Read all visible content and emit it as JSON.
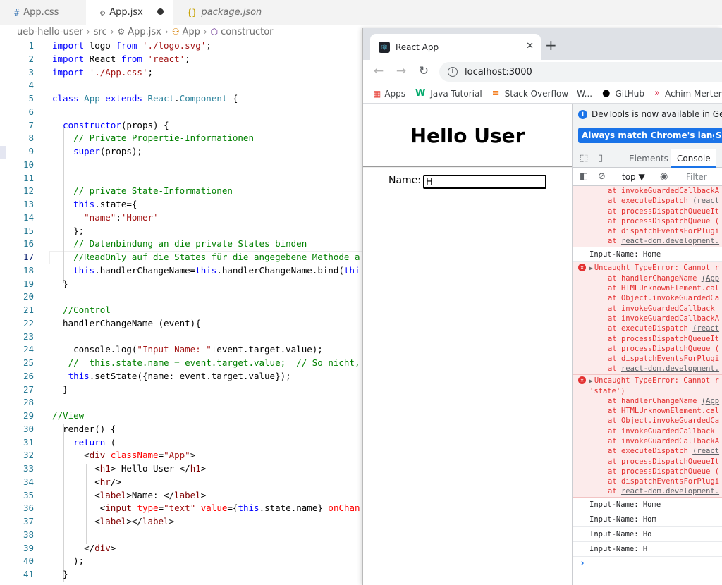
{
  "vscode": {
    "tabs": [
      {
        "icon": "#",
        "label": "App.css"
      },
      {
        "icon": "⚙",
        "label": "App.jsx"
      },
      {
        "icon": "{}",
        "label": "package.json"
      }
    ],
    "breadcrumb": [
      "ueb-hello-user",
      "src",
      "App.jsx",
      "App",
      "constructor"
    ]
  },
  "code_lines": [
    {
      "n": "1",
      "t": [
        [
          "kw",
          "import"
        ],
        [
          "",
          " logo "
        ],
        [
          "kw",
          "from"
        ],
        [
          "",
          " "
        ],
        [
          "str",
          "'./logo.svg'"
        ],
        [
          "",
          ";"
        ]
      ]
    },
    {
      "n": "2",
      "t": [
        [
          "kw",
          "import"
        ],
        [
          "",
          " React "
        ],
        [
          "kw",
          "from"
        ],
        [
          "",
          " "
        ],
        [
          "str",
          "'react'"
        ],
        [
          "",
          ";"
        ]
      ]
    },
    {
      "n": "3",
      "t": [
        [
          "kw",
          "import"
        ],
        [
          "",
          " "
        ],
        [
          "str",
          "'./App.css'"
        ],
        [
          "",
          ";"
        ]
      ]
    },
    {
      "n": "4",
      "t": []
    },
    {
      "n": "5",
      "t": [
        [
          "kw",
          "class"
        ],
        [
          "",
          " "
        ],
        [
          "cls",
          "App"
        ],
        [
          "",
          " "
        ],
        [
          "kw",
          "extends"
        ],
        [
          "",
          " "
        ],
        [
          "cls",
          "React"
        ],
        [
          "",
          "."
        ],
        [
          "cls",
          "Component"
        ],
        [
          "",
          " {"
        ]
      ]
    },
    {
      "n": "6",
      "t": []
    },
    {
      "n": "7",
      "t": [
        [
          "",
          "  "
        ],
        [
          "kw",
          "constructor"
        ],
        [
          "",
          "(props) {"
        ]
      ]
    },
    {
      "n": "8",
      "t": [
        [
          "",
          "    "
        ],
        [
          "cmt",
          "// Private Propertie-Informationen"
        ]
      ]
    },
    {
      "n": "9",
      "t": [
        [
          "",
          "    "
        ],
        [
          "kw",
          "super"
        ],
        [
          "",
          "(props);"
        ]
      ]
    },
    {
      "n": "10",
      "t": []
    },
    {
      "n": "11",
      "t": []
    },
    {
      "n": "12",
      "t": [
        [
          "",
          "    "
        ],
        [
          "cmt",
          "// private State-Informationen"
        ]
      ]
    },
    {
      "n": "13",
      "t": [
        [
          "",
          "    "
        ],
        [
          "kw",
          "this"
        ],
        [
          "",
          ".state={"
        ]
      ]
    },
    {
      "n": "14",
      "t": [
        [
          "",
          "      "
        ],
        [
          "str",
          "\"name\""
        ],
        [
          "",
          ":"
        ],
        [
          "str",
          "'Homer'"
        ]
      ]
    },
    {
      "n": "15",
      "t": [
        [
          "",
          "    };"
        ]
      ]
    },
    {
      "n": "16",
      "t": [
        [
          "",
          "    "
        ],
        [
          "cmt",
          "// Datenbindung an die private States binden"
        ]
      ]
    },
    {
      "n": "17",
      "t": [
        [
          "",
          "    "
        ],
        [
          "cmt",
          "//ReadOnly auf die States für die angegebene Methode a"
        ]
      ]
    },
    {
      "n": "18",
      "t": [
        [
          "",
          "    "
        ],
        [
          "kw",
          "this"
        ],
        [
          "",
          ".handlerChangeName="
        ],
        [
          "kw",
          "this"
        ],
        [
          "",
          ".handlerChangeName.bind("
        ],
        [
          "kw",
          "thi"
        ]
      ]
    },
    {
      "n": "19",
      "t": [
        [
          "",
          "  }"
        ]
      ]
    },
    {
      "n": "20",
      "t": []
    },
    {
      "n": "21",
      "t": [
        [
          "",
          "  "
        ],
        [
          "cmt",
          "//Control"
        ]
      ]
    },
    {
      "n": "22",
      "t": [
        [
          "",
          "  handlerChangeName (event){"
        ]
      ]
    },
    {
      "n": "23",
      "t": []
    },
    {
      "n": "24",
      "t": [
        [
          "",
          "    console.log("
        ],
        [
          "str",
          "\"Input-Name: \""
        ],
        [
          "",
          "+event.target.value);"
        ]
      ]
    },
    {
      "n": "25",
      "t": [
        [
          "",
          "   "
        ],
        [
          "cmt",
          "//  this.state.name = event.target.value;  // So nicht,"
        ]
      ]
    },
    {
      "n": "26",
      "t": [
        [
          "",
          "   "
        ],
        [
          "kw",
          "this"
        ],
        [
          "",
          ".setState({name: event.target.value});"
        ]
      ]
    },
    {
      "n": "27",
      "t": [
        [
          "",
          "  }"
        ]
      ]
    },
    {
      "n": "28",
      "t": []
    },
    {
      "n": "29",
      "t": [
        [
          "cmt",
          "//View"
        ]
      ]
    },
    {
      "n": "30",
      "t": [
        [
          "",
          "  render() {"
        ]
      ]
    },
    {
      "n": "31",
      "t": [
        [
          "",
          "    "
        ],
        [
          "kw",
          "return"
        ],
        [
          "",
          " ("
        ]
      ]
    },
    {
      "n": "32",
      "t": [
        [
          "",
          "      <"
        ],
        [
          "tag",
          "div"
        ],
        [
          "",
          " "
        ],
        [
          "attr",
          "className"
        ],
        [
          "",
          "="
        ],
        [
          "str",
          "\"App\""
        ],
        [
          "",
          ">"
        ]
      ]
    },
    {
      "n": "33",
      "t": [
        [
          "",
          "        <"
        ],
        [
          "tag",
          "h1"
        ],
        [
          "",
          "> Hello User </"
        ],
        [
          "tag",
          "h1"
        ],
        [
          "",
          ">"
        ]
      ]
    },
    {
      "n": "34",
      "t": [
        [
          "",
          "        <"
        ],
        [
          "tag",
          "hr"
        ],
        [
          "",
          "/>"
        ]
      ]
    },
    {
      "n": "35",
      "t": [
        [
          "",
          "        <"
        ],
        [
          "tag",
          "label"
        ],
        [
          "",
          ">Name: </"
        ],
        [
          "tag",
          "label"
        ],
        [
          "",
          ">"
        ]
      ]
    },
    {
      "n": "36",
      "t": [
        [
          "",
          "         <"
        ],
        [
          "tag",
          "input"
        ],
        [
          "",
          " "
        ],
        [
          "attr",
          "type"
        ],
        [
          "",
          "="
        ],
        [
          "str",
          "\"text\""
        ],
        [
          "",
          " "
        ],
        [
          "attr",
          "value"
        ],
        [
          "",
          "={"
        ],
        [
          "kw",
          "this"
        ],
        [
          "",
          ".state.name} "
        ],
        [
          "attr",
          "onChan"
        ]
      ]
    },
    {
      "n": "37",
      "t": [
        [
          "",
          "        <"
        ],
        [
          "tag",
          "label"
        ],
        [
          "",
          "></"
        ],
        [
          "tag",
          "label"
        ],
        [
          "",
          ">"
        ]
      ]
    },
    {
      "n": "38",
      "t": []
    },
    {
      "n": "39",
      "t": [
        [
          "",
          "      </"
        ],
        [
          "tag",
          "div"
        ],
        [
          "",
          ">"
        ]
      ]
    },
    {
      "n": "40",
      "t": [
        [
          "",
          "    );"
        ]
      ]
    },
    {
      "n": "41",
      "t": [
        [
          "",
          "  }"
        ]
      ]
    }
  ],
  "chrome": {
    "tab_title": "React App",
    "tab_close": "✕",
    "new_tab": "+",
    "url": "localhost:3000",
    "bookmarks": [
      "Apps",
      "Java Tutorial",
      "Stack Overflow - W...",
      "GitHub",
      "Achim Merten"
    ]
  },
  "page": {
    "heading": "Hello User",
    "name_label": "Name:",
    "name_value": "H"
  },
  "devtools": {
    "banner": "DevTools is now available in German",
    "btn_match": "Always match Chrome's language",
    "btn_switch": "Sw",
    "tab_elements": "Elements",
    "tab_console": "Console",
    "context": "top ▼",
    "filter_placeholder": "Filter"
  },
  "console": [
    {
      "type": "stack",
      "lines": [
        {
          "f": "at invokeGuardedCallbackA",
          "r": ""
        },
        {
          "f": "at executeDispatch ",
          "r": "(react"
        },
        {
          "f": "at processDispatchQueueIt",
          "r": ""
        },
        {
          "f": "at processDispatchQueue (",
          "r": ""
        },
        {
          "f": "at dispatchEventsForPlugi",
          "r": ""
        },
        {
          "f": "at ",
          "r": "react-dom.development."
        }
      ]
    },
    {
      "type": "log",
      "text": "Input-Name: Home"
    },
    {
      "type": "error",
      "head": "Uncaught TypeError: Cannot r",
      "cont": "",
      "lines": [
        {
          "f": "at handlerChangeName ",
          "r": "(App"
        },
        {
          "f": "at HTMLUnknownElement.cal",
          "r": ""
        },
        {
          "f": "at Object.invokeGuardedCa",
          "r": ""
        },
        {
          "f": "at invokeGuardedCallback",
          "r": ""
        },
        {
          "f": "at invokeGuardedCallbackA",
          "r": ""
        },
        {
          "f": "at executeDispatch ",
          "r": "(react"
        },
        {
          "f": "at processDispatchQueueIt",
          "r": ""
        },
        {
          "f": "at processDispatchQueue (",
          "r": ""
        },
        {
          "f": "at dispatchEventsForPlugi",
          "r": ""
        },
        {
          "f": "at ",
          "r": "react-dom.development."
        }
      ]
    },
    {
      "type": "error",
      "head": "Uncaught TypeError: Cannot r",
      "cont": "'state')",
      "lines": [
        {
          "f": "at handlerChangeName ",
          "r": "(App"
        },
        {
          "f": "at HTMLUnknownElement.cal",
          "r": ""
        },
        {
          "f": "at Object.invokeGuardedCa",
          "r": ""
        },
        {
          "f": "at invokeGuardedCallback",
          "r": ""
        },
        {
          "f": "at invokeGuardedCallbackA",
          "r": ""
        },
        {
          "f": "at executeDispatch ",
          "r": "(react"
        },
        {
          "f": "at processDispatchQueueIt",
          "r": ""
        },
        {
          "f": "at processDispatchQueue (",
          "r": ""
        },
        {
          "f": "at dispatchEventsForPlugi",
          "r": ""
        },
        {
          "f": "at ",
          "r": "react-dom.development."
        }
      ]
    },
    {
      "type": "log",
      "text": "Input-Name: Home"
    },
    {
      "type": "log",
      "text": "Input-Name: Hom"
    },
    {
      "type": "log",
      "text": "Input-Name: Ho"
    },
    {
      "type": "log",
      "text": "Input-Name: H"
    }
  ],
  "console_prompt": "›"
}
